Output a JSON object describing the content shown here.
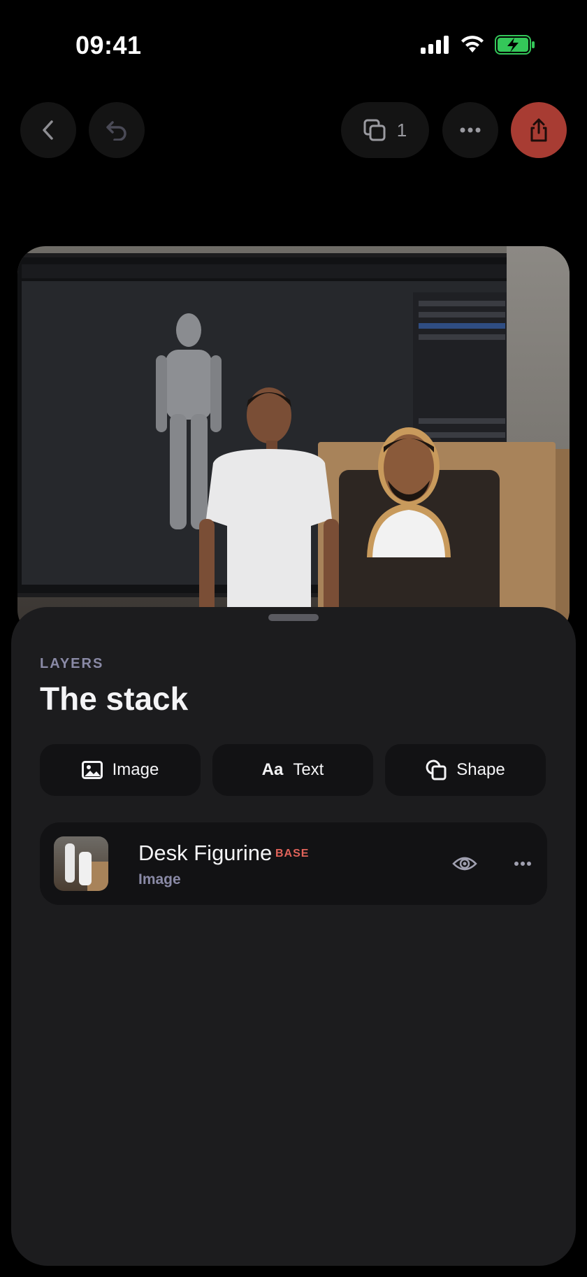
{
  "status_bar": {
    "time": "09:41",
    "icons": [
      "cellular-signal-icon",
      "wifi-icon",
      "battery-charging-icon"
    ],
    "battery_color": "#34c759"
  },
  "toolbar": {
    "back_icon": "chevron-left-icon",
    "undo_icon": "undo-icon",
    "layer_count": "1",
    "more_icon": "ellipsis-icon",
    "share_icon": "share-icon",
    "share_color": "#a83c33"
  },
  "canvas": {
    "description_icon": "image-preview"
  },
  "sheet": {
    "section_label": "LAYERS",
    "title": "The stack",
    "add_buttons": {
      "image": "Image",
      "text_glyph": "Aa",
      "text": "Text",
      "shape": "Shape"
    },
    "layers": [
      {
        "name": "Desk Figurine",
        "badge": "BASE",
        "type": "Image",
        "badge_color": "#e0635a"
      }
    ]
  }
}
